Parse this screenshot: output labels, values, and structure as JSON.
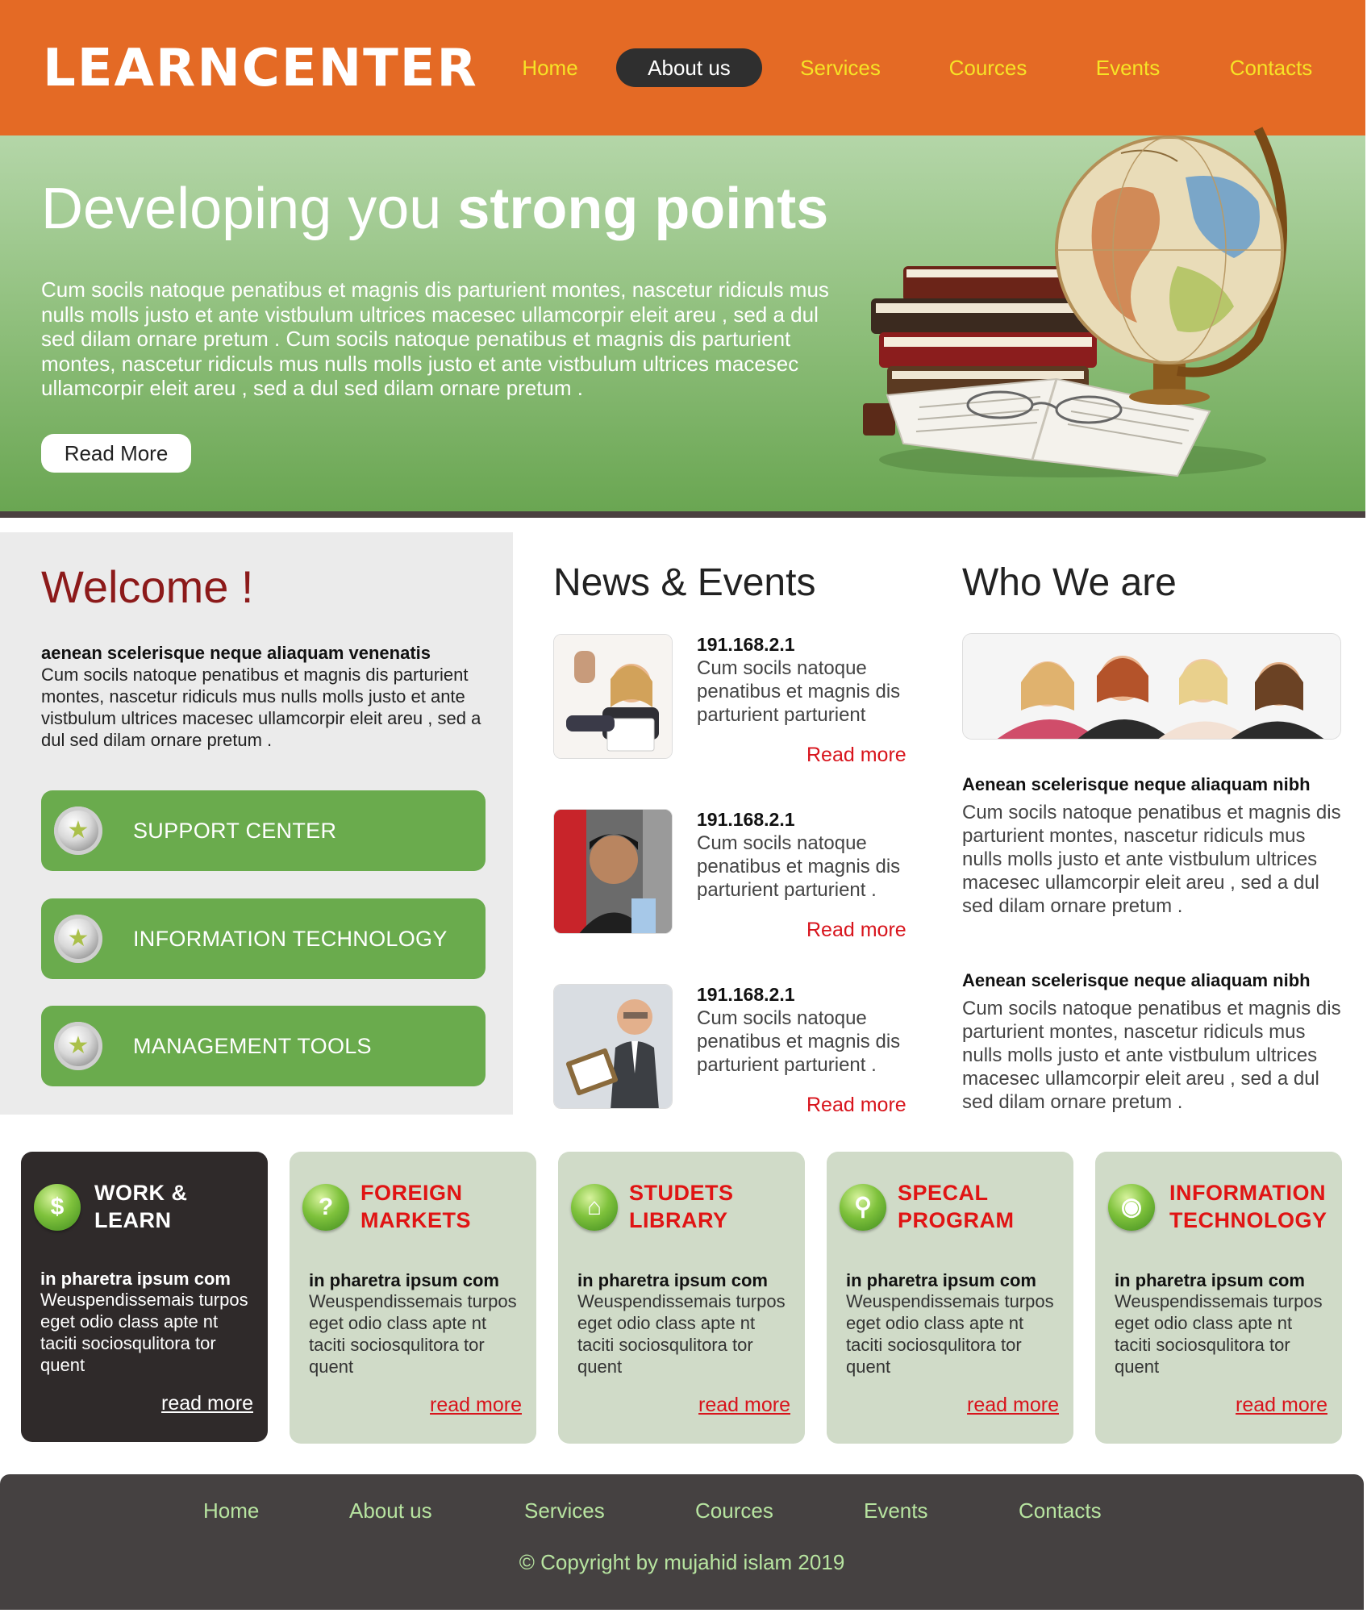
{
  "header": {
    "logo": "LEARNCENTER",
    "nav": [
      "Home",
      "About us",
      "Services",
      "Cources",
      "Events",
      "Contacts"
    ],
    "active_nav": "About us"
  },
  "hero": {
    "title_light": "Developing you ",
    "title_bold": "strong points",
    "text": "Cum socils natoque penatibus et magnis dis parturient montes, nascetur ridiculs mus nulls molls justo et ante vistbulum ultrices macesec ullamcorpir eleit areu , sed a dul sed dilam ornare pretum . Cum socils natoque penatibus et magnis dis parturient montes, nascetur ridiculs mus nulls molls justo et ante vistbulum ultrices macesec ullamcorpir eleit areu , sed a dul sed dilam ornare pretum .",
    "button": "Read More"
  },
  "welcome": {
    "title": "Welcome !",
    "subtitle": "aenean scelerisque neque aliaquam venenatis",
    "text": "Cum socils natoque penatibus et magnis dis parturient montes, nascetur ridiculs mus nulls molls justo et ante vistbulum ultrices macesec ullamcorpir eleit areu , sed a dul sed dilam ornare pretum .",
    "buttons": [
      "SUPPORT CENTER",
      "INFORMATION TECHNOLOGY",
      "MANAGEMENT TOOLS"
    ]
  },
  "news": {
    "title": "News & Events",
    "items": [
      {
        "ip": "191.168.2.1",
        "text": "Cum socils natoque penatibus et magnis dis parturient parturient",
        "more": "Read more"
      },
      {
        "ip": "191.168.2.1",
        "text": "Cum socils natoque penatibus et magnis dis parturient parturient .",
        "more": "Read more"
      },
      {
        "ip": "191.168.2.1",
        "text": "Cum socils natoque penatibus et magnis dis parturient parturient .",
        "more": "Read more"
      }
    ]
  },
  "who": {
    "title": "Who We are",
    "blocks": [
      {
        "heading": "Aenean scelerisque neque aliaquam nibh",
        "text": "Cum socils natoque penatibus et magnis dis parturient montes, nascetur ridiculs mus nulls molls justo et ante vistbulum ultrices macesec ullamcorpir eleit areu , sed a dul sed dilam ornare pretum ."
      },
      {
        "heading": "Aenean scelerisque neque aliaquam nibh",
        "text": "Cum socils natoque penatibus et magnis dis parturient montes, nascetur ridiculs mus nulls molls justo et ante vistbulum ultrices macesec ullamcorpir eleit areu , sed a dul sed dilam ornare pretum ."
      }
    ]
  },
  "cards": [
    {
      "icon": "dollar-icon",
      "glyph": "$",
      "title1": "WORK &",
      "title2": "LEARN",
      "sub": "in pharetra ipsum com",
      "text": "Weuspendissemais turpos eget odio class apte nt taciti sociosqulitora tor quent",
      "more": "read more"
    },
    {
      "icon": "question-icon",
      "glyph": "?",
      "title1": "FOREIGN",
      "title2": "MARKETS",
      "sub": "in pharetra ipsum com",
      "text": "Weuspendissemais turpos eget odio class apte nt taciti sociosqulitora tor quent",
      "more": "read more"
    },
    {
      "icon": "home-icon",
      "glyph": "⌂",
      "title1": "STUDETS",
      "title2": "LIBRARY",
      "sub": "in pharetra ipsum com",
      "text": "Weuspendissemais turpos eget odio class apte nt taciti sociosqulitora tor quent",
      "more": "read more"
    },
    {
      "icon": "magnifier-icon",
      "glyph": "⚲",
      "title1": "SPECAL",
      "title2": "PROGRAM",
      "sub": "in pharetra ipsum com",
      "text": "Weuspendissemais turpos eget odio class apte nt taciti sociosqulitora tor quent",
      "more": "read more"
    },
    {
      "icon": "pin-icon",
      "glyph": "◉",
      "title1": "INFORMATION",
      "title2": "TECHNOLOGY",
      "sub": "in pharetra ipsum com",
      "text": "Weuspendissemais turpos eget odio class apte nt taciti sociosqulitora tor quent",
      "more": "read more"
    }
  ],
  "footer": {
    "nav": [
      "Home",
      "About us",
      "Services",
      "Cources",
      "Events",
      "Contacts"
    ],
    "copyright": "© Copyright by mujahid islam 2019"
  },
  "colors": {
    "header_orange": "#e46a25",
    "nav_yellow": "#f6e326",
    "hero_green": "#8fbf7c",
    "button_green": "#6aab4d",
    "accent_red": "#d8141c",
    "card_bg": "#d0dbc8",
    "dark_card": "#2f2a2a",
    "footer_bg": "#454141",
    "footer_text": "#b7e4a0"
  }
}
